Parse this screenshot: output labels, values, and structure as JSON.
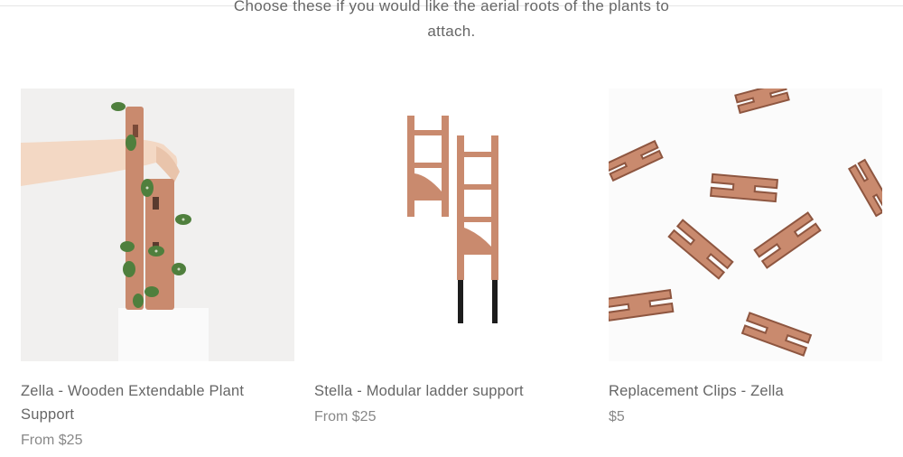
{
  "intro": {
    "line1": "Choose these if you would like the aerial roots of the plants to",
    "line2": "attach."
  },
  "products": [
    {
      "title": "Zella - Wooden Extendable Plant Support",
      "price": "From $25"
    },
    {
      "title": "Stella - Modular ladder support",
      "price": "From $25"
    },
    {
      "title": "Replacement Clips - Zella",
      "price": "$5"
    }
  ],
  "colors": {
    "wood": "#c98a6e",
    "wood_dark": "#a5644a",
    "leaf": "#4f7f3d",
    "text": "#666666",
    "price": "#888888"
  }
}
